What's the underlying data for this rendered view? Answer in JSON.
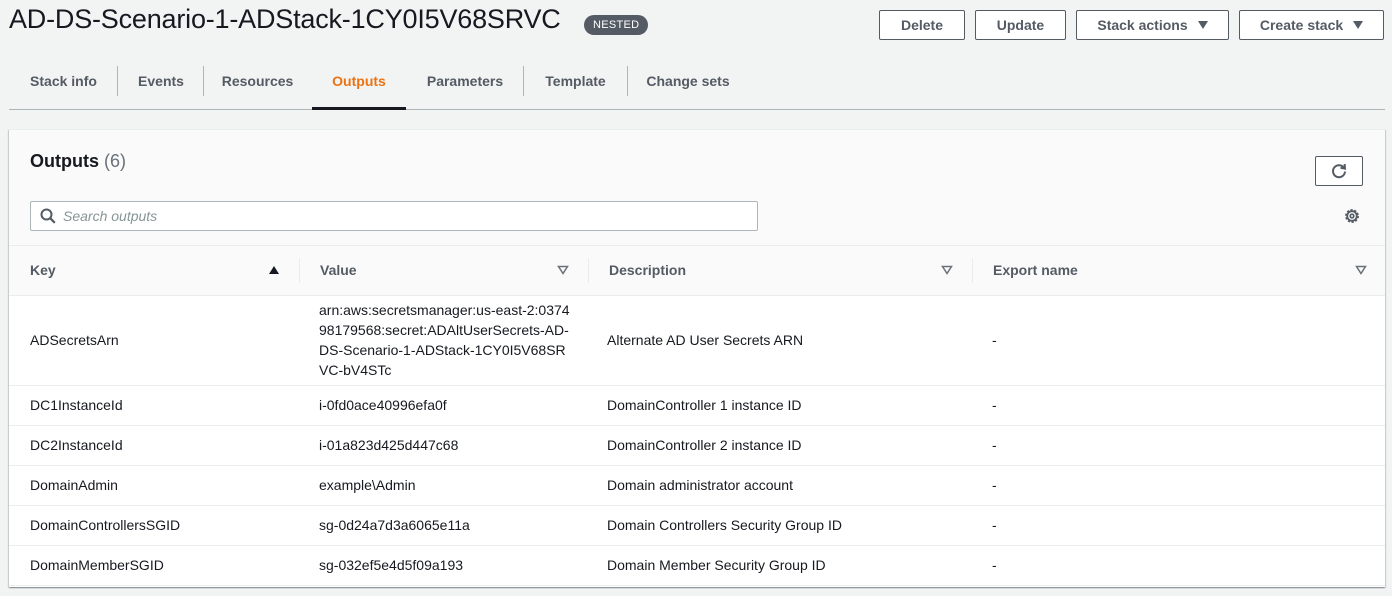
{
  "header": {
    "title": "AD-DS-Scenario-1-ADStack-1CY0I5V68SRVC",
    "badge": "NESTED",
    "buttons": {
      "delete": "Delete",
      "update": "Update",
      "stack_actions": "Stack actions",
      "create_stack": "Create stack"
    }
  },
  "tabs": [
    {
      "label": "Stack info"
    },
    {
      "label": "Events"
    },
    {
      "label": "Resources"
    },
    {
      "label": "Outputs",
      "active": true
    },
    {
      "label": "Parameters"
    },
    {
      "label": "Template"
    },
    {
      "label": "Change sets"
    }
  ],
  "outputs": {
    "title": "Outputs",
    "count": "(6)",
    "search_placeholder": "Search outputs",
    "columns": [
      "Key",
      "Value",
      "Description",
      "Export name"
    ],
    "rows": [
      {
        "key": "ADSecretsArn",
        "value": "arn:aws:secretsmanager:us-east-2:037498179568:secret:ADAltUserSecrets-AD-DS-Scenario-1-ADStack-1CY0I5V68SRVC-bV4STc",
        "description": "Alternate AD User Secrets ARN",
        "export": "-"
      },
      {
        "key": "DC1InstanceId",
        "value": "i-0fd0ace40996efa0f",
        "description": "DomainController 1 instance ID",
        "export": "-"
      },
      {
        "key": "DC2InstanceId",
        "value": "i-01a823d425d447c68",
        "description": "DomainController 2 instance ID",
        "export": "-"
      },
      {
        "key": "DomainAdmin",
        "value": "example\\Admin",
        "description": "Domain administrator account",
        "export": "-"
      },
      {
        "key": "DomainControllersSGID",
        "value": "sg-0d24a7d3a6065e11a",
        "description": "Domain Controllers Security Group ID",
        "export": "-"
      },
      {
        "key": "DomainMemberSGID",
        "value": "sg-032ef5e4d5f09a193",
        "description": "Domain Member Security Group ID",
        "export": "-"
      }
    ]
  },
  "icons": {
    "refresh": "refresh-icon",
    "search": "search-icon",
    "settings": "gear-icon",
    "sort_asc": "sort-ascending-icon",
    "sort_filter": "sort-toggle-icon"
  },
  "colors": {
    "accent": "#ec7211",
    "badge_bg": "#545b64",
    "text": "#16191f"
  }
}
